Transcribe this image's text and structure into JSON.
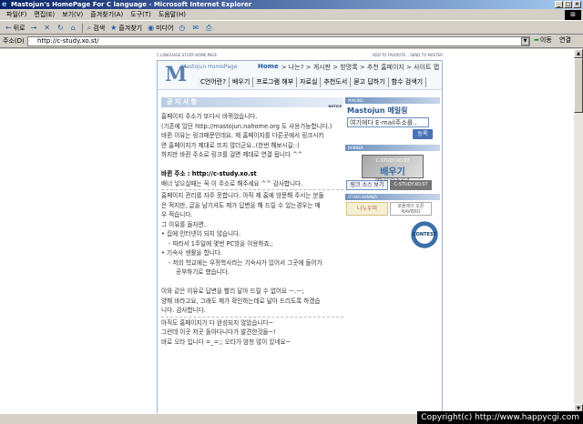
{
  "window": {
    "title": "Mastojun's HomePage For C language - Microsoft Internet Explorer",
    "controls": {
      "minimize": "_",
      "maximize": "□",
      "close": "×"
    }
  },
  "menu": [
    "파일(F)",
    "편집(E)",
    "보기(V)",
    "즐겨찾기(A)",
    "도구(T)",
    "도움말(H)"
  ],
  "toolbar": {
    "back": "뒤로",
    "forward": "",
    "search": "검색",
    "favorites": "즐겨찾기",
    "media": "미디어"
  },
  "address": {
    "label": "주소(D)",
    "url": "http://c-study.xo.st/",
    "go": "이동",
    "links": "연결"
  },
  "site": {
    "top_left": "C LANGUAGE STUDY HOME PAGE",
    "top_right": "ADD TO FAVORITE :: SEND TO MASTER",
    "logo_letter": "M",
    "logo_text": "Mastojun HomePage",
    "nav": [
      "Home",
      "> 나는? > 게시판 > 방명록 > 추천 홈페이지 > 사이트 맵"
    ],
    "subnav": [
      "C언어란?",
      "배우기",
      "프로그램 해부",
      "자료실",
      "추천도서",
      "묻고 답하기",
      "함수 검색기"
    ],
    "notice_title": "공 지 사 항",
    "notice_tag": "NOTICE",
    "content": [
      "홈페이지 주소가 또다시 바뀌었습니다.",
      "(기존에 있던 http://mastojun.nahome.org 도 사용가능합니다.)",
      "바뀐 이유는 링크때문인데요. 제 홈페이지를 다른곳에서 링크시키",
      "면 홈페이지가 제대로 뜨지 않더군요..(한번 해보시길::)",
      "하지만 바뀐 주소로 링크를 걸면 제대로 연결 됩니다 ^^",
      "",
      "바뀐 주소 : http://c-study.xo.st",
      "배너 넣으실때는 꼭 이 주소로 해주세요 ^^ 감사합니다.",
      "홈페이지 관리를 자주 못합니다. 아직 제 홈에 방문해 주시는 분들",
      "은 적지만, 글을 남기셔도 제가 답변을 해 드릴 수 있는경우는 매",
      "우 적습니다.",
      "그 이유를 들자면..",
      "집에 인터넷이 되지 않습니다.",
      "- 따라서 1주일에 몇번 PC방을 이용하죠.;",
      "기숙사 생활을 합니다.",
      "- 저희 학교에는 우정학사라는 기숙사가 있어서 그곳에 들어가",
      "공부하기로 했습니다.",
      "",
      "이와 같은 이유로 답변을 빨리 달아 드릴 수 없어요 ㅡ.ㅡ;",
      "양해 바라고요, 그래도 제가 확인하는데로 달아 드리도록 하겠습",
      "니다. 감사합니다.",
      "아직도 홈페이지가 다 완성되지 않았습니다~",
      "그런데 이곳 저곳 돌아다니다가 발견한것들~!",
      "바로 오타 입니다 =_=;; 오타가 엄청 많이 있네요~"
    ],
    "sidebar": {
      "mailing_hdr": "MAILING",
      "mail_title": "Mastojun 메일링",
      "mail_placeholder": "여기에다 E-mail주소를..",
      "reg_btn": "등록",
      "banner_hdr": "BANNER",
      "banner_text": "C-STUDY.XO.ST",
      "banner_big": "배우기",
      "banner_sub": "http://c-study.xo.st",
      "link_src": "링크 소스 보기",
      "link_banner": "C-STUDY.XO.ST",
      "other_hdr": "OTHER BANNER",
      "other1": "나누우미",
      "other2": "포플레이 오픈 NAVERO",
      "contest": "CONTEST"
    }
  },
  "copyright": "Copyright(c) http://www.happycgi.com"
}
